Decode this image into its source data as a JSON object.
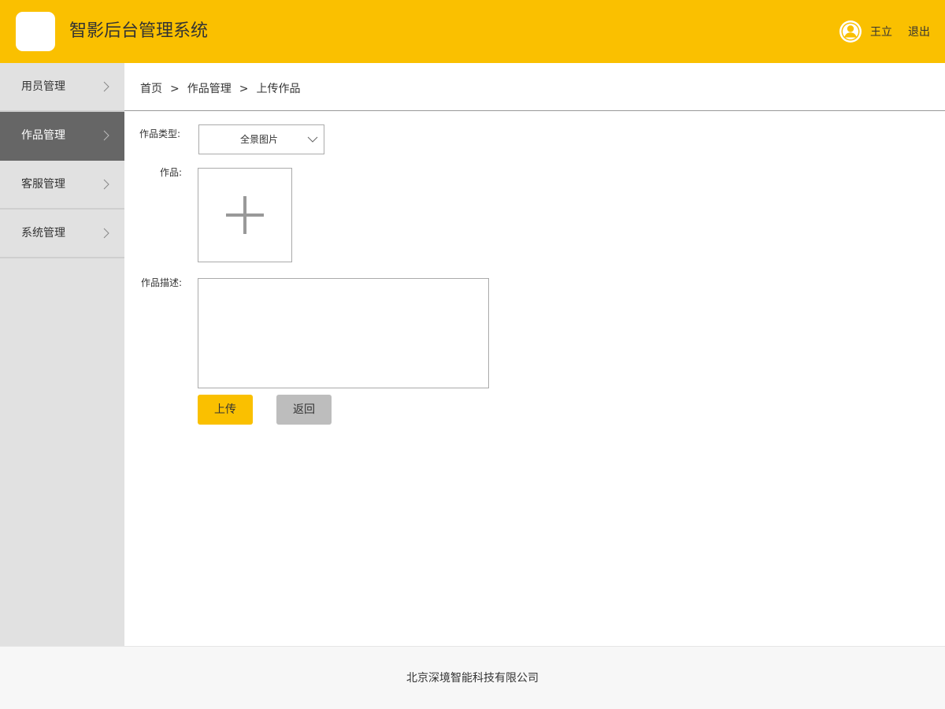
{
  "header": {
    "title": "智影后台管理系统",
    "user_name": "王立",
    "logout_label": "退出",
    "accent_color": "#FAC000"
  },
  "sidebar": {
    "items": [
      {
        "label": "用员管理",
        "icon": "chevron-right-icon",
        "active": false
      },
      {
        "label": "作品管理",
        "icon": "chevron-right-icon",
        "active": true
      },
      {
        "label": "客服管理",
        "icon": "chevron-right-icon",
        "active": false
      },
      {
        "label": "系统管理",
        "icon": "chevron-right-icon",
        "active": false
      }
    ]
  },
  "breadcrumb": {
    "items": [
      "首页",
      "作品管理",
      "上传作品"
    ],
    "separator": ">"
  },
  "form": {
    "type_label": "作品类型:",
    "type_value": "全景图片",
    "work_label": "作品:",
    "upload_icon": "plus-icon",
    "desc_label": "作品描述:",
    "desc_value": "",
    "submit_label": "上传",
    "back_label": "返回"
  },
  "footer": {
    "company": "北京深境智能科技有限公司"
  }
}
